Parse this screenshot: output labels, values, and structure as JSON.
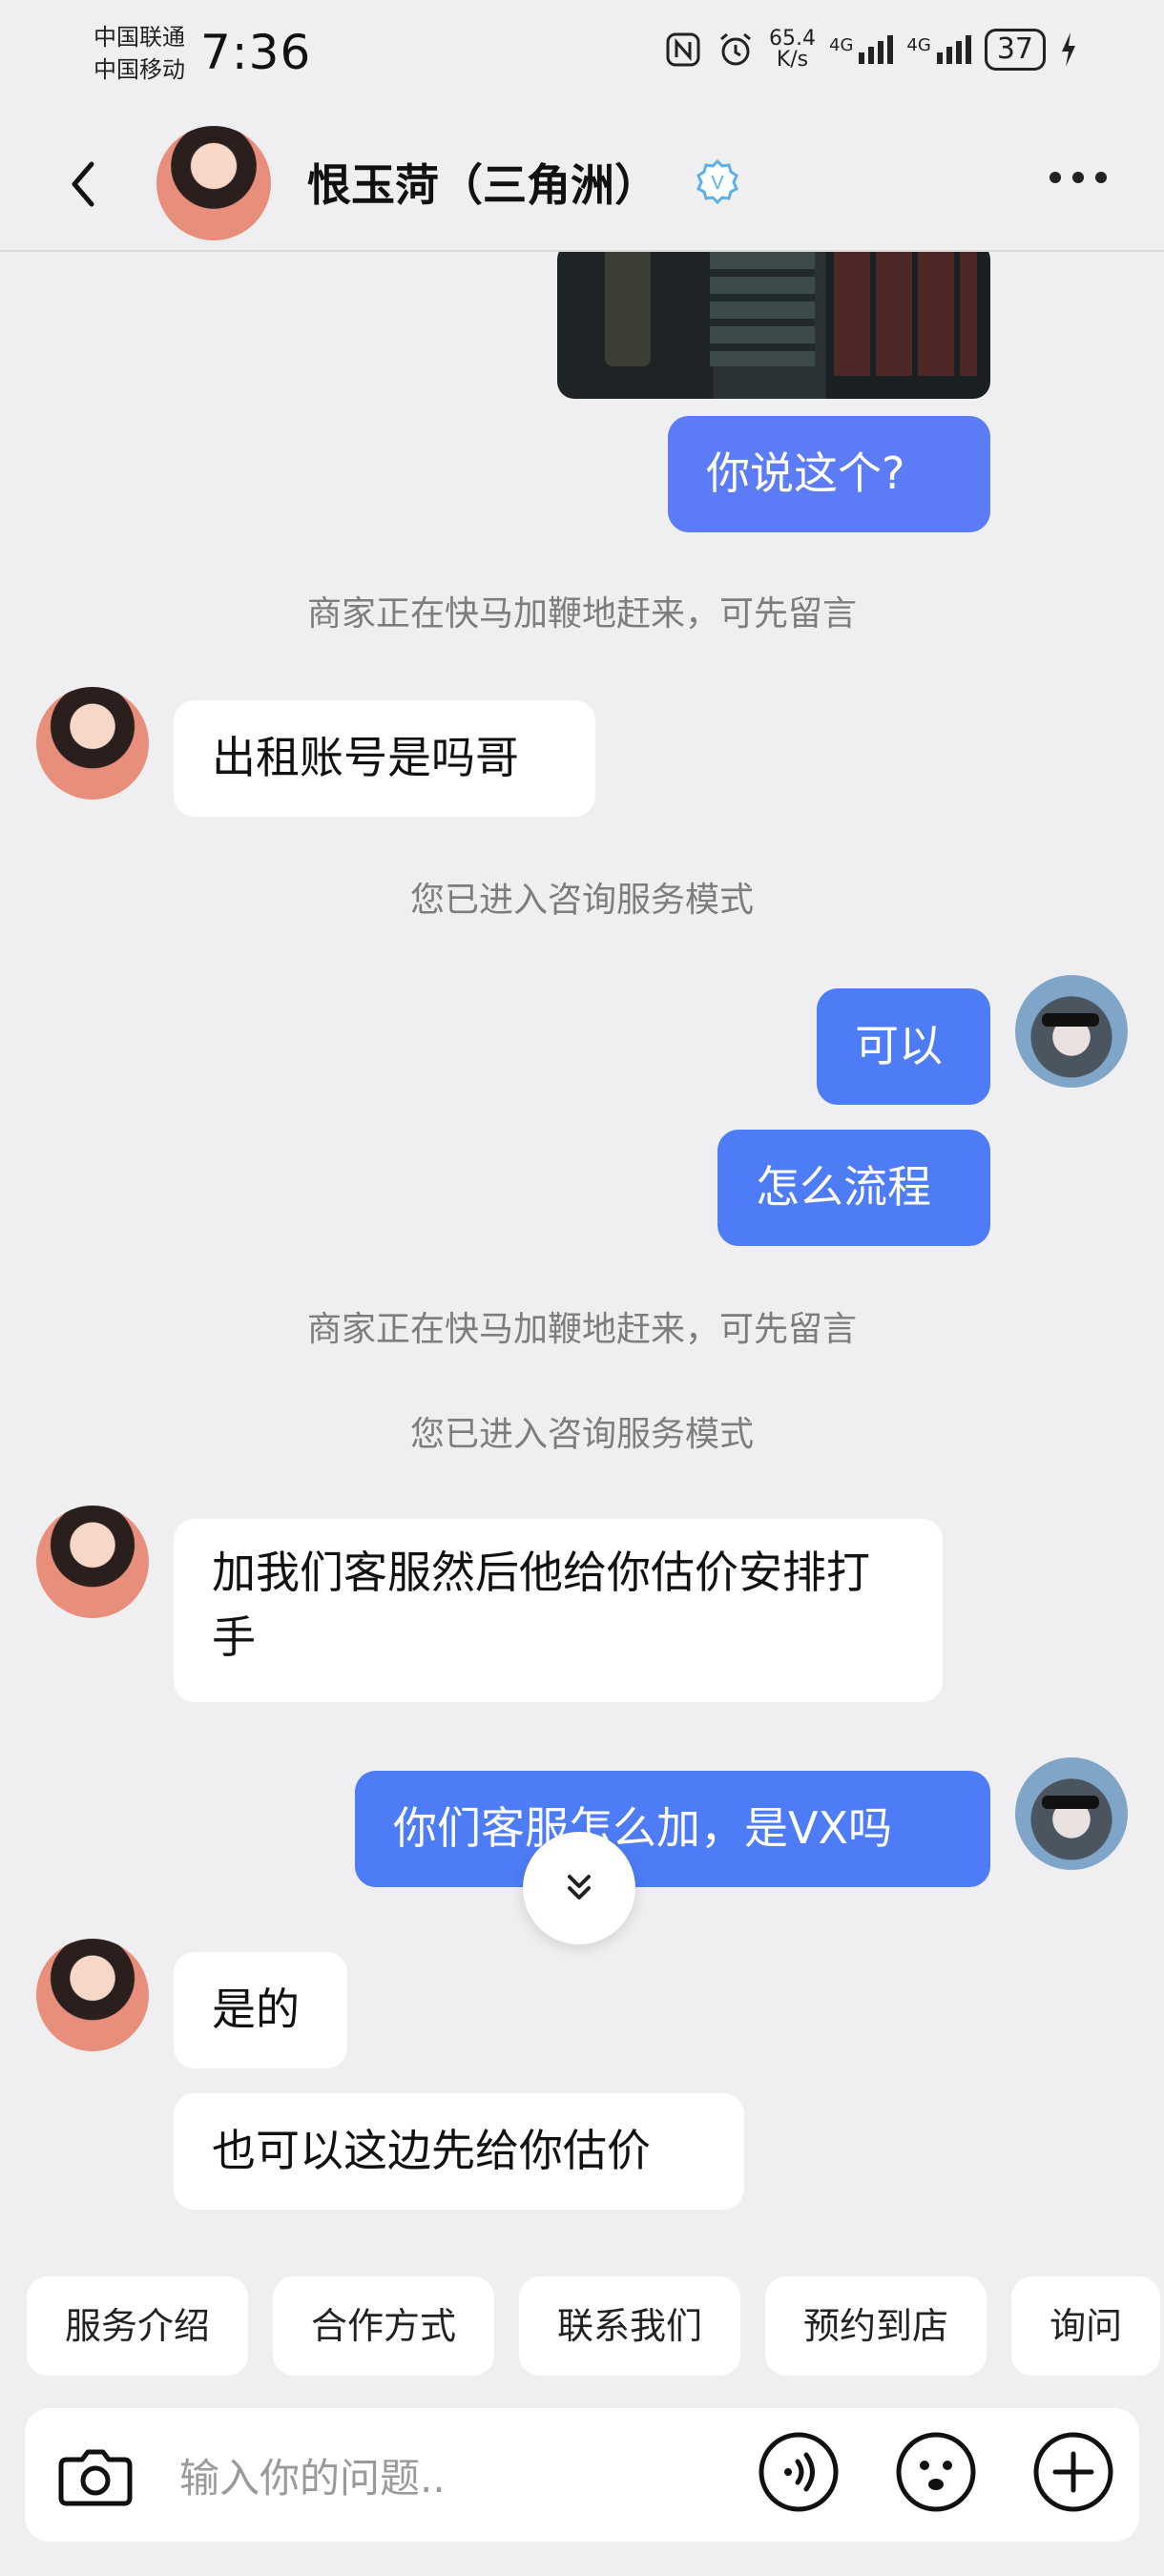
{
  "status": {
    "carrier1": "中国联通",
    "carrier2": "中国移动",
    "time": "7:36",
    "speed_value": "65.4",
    "speed_unit": "K/s",
    "net1": "4G",
    "net2": "4G",
    "battery": "37",
    "icons": [
      "nfc-icon",
      "alarm-icon",
      "signal-icon",
      "charging-icon"
    ]
  },
  "header": {
    "title": "恨玉菏（三角洲）",
    "verified_mark": "V",
    "icons": [
      "back-arrow-icon",
      "verified-badge-icon",
      "more-icon"
    ]
  },
  "messages": {
    "m1": "你说这个?",
    "sys1": "商家正在快马加鞭地赶来，可先留言",
    "m2": "出租账号是吗哥",
    "sys2": "您已进入咨询服务模式",
    "m3": "可以",
    "m4": "怎么流程",
    "sys3": "商家正在快马加鞭地赶来，可先留言",
    "sys4": "您已进入咨询服务模式",
    "m5": "加我们客服然后他给你估价安排打手",
    "m6": "你们客服怎么加，是VX吗",
    "m7": "是的",
    "m8": "也可以这边先给你估价"
  },
  "quick_replies": [
    "服务介绍",
    "合作方式",
    "联系我们",
    "预约到店",
    "询问"
  ],
  "input": {
    "placeholder": "输入你的问题.."
  },
  "colors": {
    "outgoing_bubble": "#4e7cf6",
    "incoming_bubble": "#ffffff",
    "background": "#efeff1",
    "verified": "#5ab0e8"
  }
}
